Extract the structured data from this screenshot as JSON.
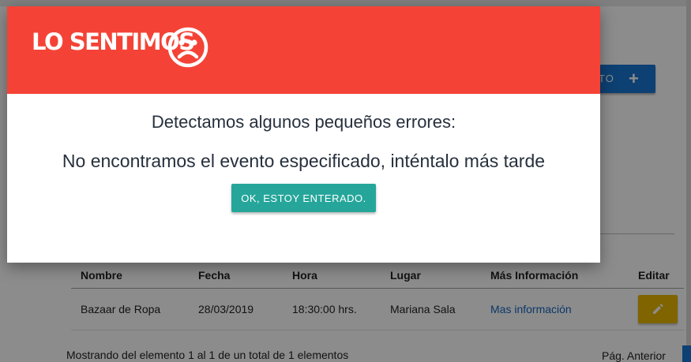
{
  "page": {
    "add_button": {
      "label": "TO",
      "icon": "plus-icon"
    },
    "table": {
      "headers": [
        "Nombre",
        "Fecha",
        "Hora",
        "Lugar",
        "Más Información",
        "Editar"
      ],
      "rows": [
        {
          "nombre": "Bazaar de Ropa",
          "fecha": "28/03/2019",
          "hora": "18:30:00 hrs.",
          "lugar": "Mariana Sala",
          "info_link": "Mas información",
          "edit_icon": "pencil-icon"
        }
      ]
    },
    "footer": {
      "summary": "Mostrando del elemento 1 al 1 de un total de 1 elementos",
      "prev_page": "Pág. Anterior"
    }
  },
  "modal": {
    "title": "LO SENTIMOS",
    "title_icon": "sad-face-icon",
    "subtitle": "Detectamos algunos pequeños errores:",
    "message": "No encontramos el evento especificado, inténtalo más tarde",
    "ok_button": "OK, ESTOY ENTERADO.",
    "header_color": "#f44336",
    "ok_color": "#26a69a"
  }
}
